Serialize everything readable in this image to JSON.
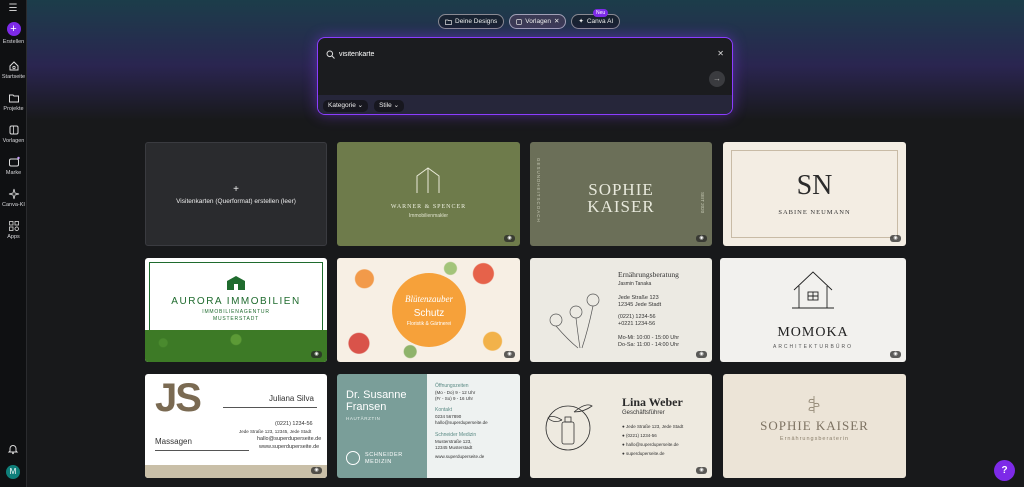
{
  "sidebar": {
    "create": "Erstellen",
    "items": [
      {
        "label": "Startseite",
        "icon": "home-icon"
      },
      {
        "label": "Projekte",
        "icon": "folder-icon"
      },
      {
        "label": "Vorlagen",
        "icon": "template-icon"
      },
      {
        "label": "Marke",
        "icon": "brand-icon"
      },
      {
        "label": "Canva-KI",
        "icon": "sparkle-icon"
      },
      {
        "label": "Apps",
        "icon": "apps-icon"
      }
    ],
    "avatar_letter": "M"
  },
  "chips": {
    "designs": "Deine Designs",
    "templates": "Vorlagen",
    "ai": "Canva AI",
    "new_badge": "Neu"
  },
  "search": {
    "value": "visitenkarte",
    "filter_category": "Kategorie",
    "filter_style": "Stile"
  },
  "cards": {
    "blank_label": "Visitenkarten (Querformat) erstellen (leer)",
    "c2_name": "WARNER & SPENCER",
    "c2_sub": "Immobilienmakler",
    "c3_name1": "SOPHIE",
    "c3_name2": "KAISER",
    "c3_side": "GESUNDHEITSCOACH",
    "c3_year": "SEIT 2020",
    "c4_mono": "SN",
    "c4_name": "SABINE NEUMANN",
    "c5_name": "AURORA IMMOBILIEN",
    "c5_sub1": "IMMOBILIENAGENTUR",
    "c5_sub2": "MUSTERSTADT",
    "c6_script": "Blütenzauber",
    "c6_name": "Schutz",
    "c6_sub": "Floristik & Gärtnerei",
    "c7_title": "Ernährungsberatung",
    "c7_name": "Jasmin Tanaka",
    "c7_addr1": "Jede Straße 123",
    "c7_addr2": "12345 Jede Stadt",
    "c7_phone1": "(0221) 1234-56",
    "c7_phone2": "+0221 1234-56",
    "c7_hours1": "Mo-Mi: 10:00 - 15:00 Uhr",
    "c7_hours2": "Do-Sa: 11:00 - 14:00 Uhr",
    "c8_name": "MOMOKA",
    "c8_sub": "ARCHITEKTURBÜRO",
    "c9_initials": "JS",
    "c9_name": "Juliana Silva",
    "c9_role": "Massagen",
    "c9_phone": "(0221) 1234-56",
    "c9_addr": "Jede Straße 123, 12345, Jede Stadt",
    "c9_mail": "hallo@superduperseite.de",
    "c9_web": "www.superduperseite.de",
    "c10_name1": "Dr. Susanne",
    "c10_name2": "Fransen",
    "c10_role": "HAUTÄRZTIN",
    "c10_logo1": "SCHNEIDER",
    "c10_logo2": "MEDIZIN",
    "c10_hours_t": "Öffnungszeiten",
    "c10_hours1": "(Mo - Do) 9 - 12 Uhr",
    "c10_hours2": "(Fr - So) 9 - 16 Uhr",
    "c10_contact_t": "Kontakt",
    "c10_phone": "0234 567890",
    "c10_mail": "hallo@superduperseite.de",
    "c10_clinic": "Schneider Medizin",
    "c10_street": "Musterstraße 123,",
    "c10_city": "12345 Musterstadt",
    "c10_web": "www.superduperseite.de",
    "c11_name": "Lina Weber",
    "c11_role": "Geschäftsführer",
    "c11_addr": "Jede Straße 123, Jede Stadt",
    "c11_phone": "(0221) 1234-56",
    "c11_mail": "hallo@superduperseite.de",
    "c11_web": "superduperseite.de",
    "c12_name": "SOPHIE KAISER",
    "c12_sub": "Ernährungsberaterin"
  },
  "colors": {
    "accent": "#7d2ae8",
    "search_border": "#8b3dff"
  }
}
